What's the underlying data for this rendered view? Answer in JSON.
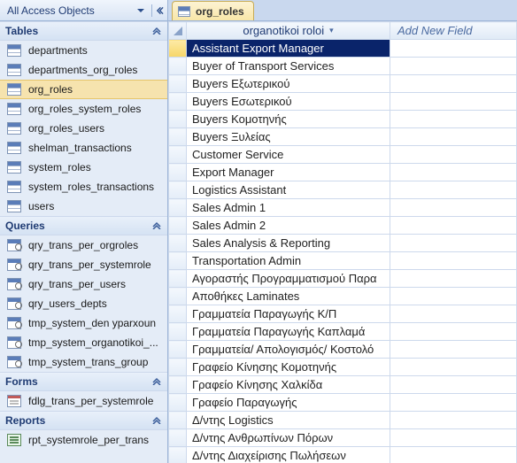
{
  "nav": {
    "title": "All Access Objects",
    "groups": [
      {
        "name": "Tables",
        "items": [
          {
            "label": "departments"
          },
          {
            "label": "departments_org_roles"
          },
          {
            "label": "org_roles",
            "selected": true
          },
          {
            "label": "org_roles_system_roles"
          },
          {
            "label": "org_roles_users"
          },
          {
            "label": "shelman_transactions"
          },
          {
            "label": "system_roles"
          },
          {
            "label": "system_roles_transactions"
          },
          {
            "label": "users"
          }
        ]
      },
      {
        "name": "Queries",
        "items": [
          {
            "label": "qry_trans_per_orgroles"
          },
          {
            "label": "qry_trans_per_systemrole"
          },
          {
            "label": "qry_trans_per_users"
          },
          {
            "label": "qry_users_depts"
          },
          {
            "label": "tmp_system_den yparxoun"
          },
          {
            "label": "tmp_system_organotikoi_..."
          },
          {
            "label": "tmp_system_trans_group"
          }
        ]
      },
      {
        "name": "Forms",
        "items": [
          {
            "label": "fdlg_trans_per_systemrole"
          }
        ]
      },
      {
        "name": "Reports",
        "items": [
          {
            "label": "rpt_systemrole_per_trans"
          }
        ]
      }
    ]
  },
  "tab": {
    "label": "org_roles"
  },
  "grid": {
    "column_header": "organotikoi roloi",
    "add_field": "Add New Field",
    "rows": [
      "Assistant Export Manager",
      "Buyer of Transport Services",
      "Buyers Εξωτερικού",
      "Buyers Εσωτερικού",
      "Buyers Κομοτηνής",
      "Buyers Ξυλείας",
      "Customer Service",
      "Export Manager",
      "Logistics Assistant",
      "Sales Admin 1",
      "Sales Admin 2",
      "Sales Analysis & Reporting",
      "Transportation Admin",
      "Αγοραστής Προγραμματισμού Παρα",
      "Αποθήκες Laminates",
      "Γραμματεία Παραγωγής Κ/Π",
      "Γραμματεία Παραγωγής Καπλαμά",
      "Γραμματεία/ Απολογισμός/ Κοστολό",
      "Γραφείο Κίνησης Κομοτηνής",
      "Γραφείο Κίνησης Χαλκίδα",
      "Γραφείο Παραγωγής",
      "Δ/ντης Logistics",
      "Δ/ντης Ανθρωπίνων Πόρων",
      "Δ/ντης Διαχείρισης Πωλήσεων"
    ]
  }
}
